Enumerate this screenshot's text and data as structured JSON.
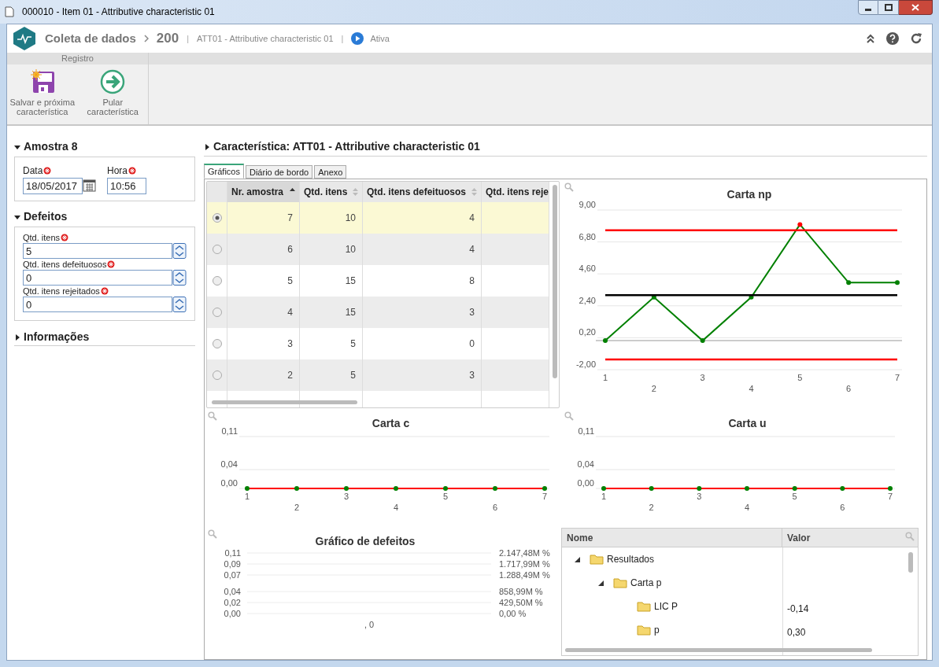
{
  "window": {
    "title": "000010 - Item 01 - Attributive characteristic 01"
  },
  "header": {
    "module": "Coleta de dados",
    "number": "200",
    "separator_1": "|",
    "characteristic": "ATT01 - Attributive characteristic 01",
    "separator_2": "|",
    "status": "Ativa"
  },
  "ribbon": {
    "group": "Registro",
    "buttons": [
      {
        "kind": "save",
        "label": "Salvar e próxima característica"
      },
      {
        "kind": "skip",
        "label": "Pular característica"
      }
    ]
  },
  "left": {
    "sample": {
      "title": "Amostra 8",
      "expanded": true,
      "date_label": "Data",
      "date": "18/05/2017",
      "time_label": "Hora",
      "time": "10:56"
    },
    "defects": {
      "title": "Defeitos",
      "expanded": true,
      "fields": [
        {
          "label": "Qtd. itens",
          "value": "5"
        },
        {
          "label": "Qtd. itens defeituosos",
          "value": "0"
        },
        {
          "label": "Qtd. itens rejeitados",
          "value": "0"
        }
      ]
    },
    "info": {
      "title": "Informações",
      "expanded": false
    }
  },
  "main": {
    "title": "Característica: ATT01 - Attributive characteristic 01",
    "tabs": [
      {
        "label": "Gráficos",
        "selected": true
      },
      {
        "label": "Diário de bordo",
        "selected": false
      },
      {
        "label": "Anexo",
        "selected": false
      }
    ],
    "table": {
      "columns": [
        "Nr. amostra",
        "Qtd. itens",
        "Qtd. itens defeituosos",
        "Qtd. itens reje"
      ],
      "rows": [
        {
          "selected": true,
          "cells": [
            "7",
            "10",
            "4",
            ""
          ]
        },
        {
          "selected": false,
          "cells": [
            "6",
            "10",
            "4",
            ""
          ]
        },
        {
          "selected": false,
          "cells": [
            "5",
            "15",
            "8",
            ""
          ]
        },
        {
          "selected": false,
          "cells": [
            "4",
            "15",
            "3",
            ""
          ]
        },
        {
          "selected": false,
          "cells": [
            "3",
            "5",
            "0",
            ""
          ]
        },
        {
          "selected": false,
          "cells": [
            "2",
            "5",
            "3",
            ""
          ]
        }
      ]
    },
    "chart_np": {
      "chart_data": {
        "type": "line",
        "title": "Carta np",
        "categories": [
          "1",
          "2",
          "3",
          "4",
          "5",
          "6",
          "7"
        ],
        "ylim": [
          -2,
          9
        ],
        "yticks": [
          {
            "value": -2,
            "label": "-2,00"
          },
          {
            "value": 0.2,
            "label": "0,20"
          },
          {
            "value": 2.4,
            "label": "2,40"
          },
          {
            "value": 4.6,
            "label": "4,60"
          },
          {
            "value": 6.8,
            "label": "6,80"
          },
          {
            "value": 9,
            "label": "9,00"
          }
        ],
        "grid": true,
        "series": [
          {
            "color": "#008000",
            "marker": true,
            "values": [
              0,
              3,
              0,
              3,
              8,
              4,
              4
            ]
          },
          {
            "color": "#ff0000",
            "values": [
              7.6,
              7.6,
              7.6,
              7.6,
              7.6,
              7.6,
              7.6
            ]
          },
          {
            "color": "#000000",
            "values": [
              3.14,
              3.14,
              3.14,
              3.14,
              3.14,
              3.14,
              3.14
            ]
          },
          {
            "color": "#ff0000",
            "values": [
              -1.3,
              -1.3,
              -1.3,
              -1.3,
              -1.3,
              -1.3,
              -1.3
            ]
          }
        ]
      }
    },
    "chart_c": {
      "chart_data": {
        "type": "line",
        "title": "Carta c",
        "categories": [
          "1",
          "2",
          "3",
          "4",
          "5",
          "6",
          "7"
        ],
        "ylim": [
          0,
          0.11
        ],
        "yticks": [
          {
            "value": 0,
            "label": "0,00"
          },
          {
            "value": 0.04,
            "label": "0,04"
          },
          {
            "value": 0.11,
            "label": "0,11"
          }
        ],
        "grid": true,
        "series": [
          {
            "color": "#ff0000",
            "marker": true,
            "values": [
              0,
              0,
              0,
              0,
              0,
              0,
              0
            ]
          }
        ]
      }
    },
    "chart_u": {
      "chart_data": {
        "type": "line",
        "title": "Carta u",
        "categories": [
          "1",
          "2",
          "3",
          "4",
          "5",
          "6",
          "7"
        ],
        "ylim": [
          0,
          0.11
        ],
        "yticks": [
          {
            "value": 0,
            "label": "0,00"
          },
          {
            "value": 0.04,
            "label": "0,04"
          },
          {
            "value": 0.11,
            "label": "0,11"
          }
        ],
        "grid": true,
        "series": [
          {
            "color": "#ff0000",
            "marker": true,
            "values": [
              0,
              0,
              0,
              0,
              0,
              0,
              0
            ]
          }
        ]
      }
    },
    "chart_defects": {
      "chart_data": {
        "type": "bar",
        "grid": true,
        "title": "Gráfico de defeitos",
        "categories": [
          ", 0"
        ],
        "values": [
          0
        ],
        "ylim": [
          0,
          0.11
        ],
        "yticks": [
          {
            "value": 0,
            "label": "0,00"
          },
          {
            "value": 0.02,
            "label": "0,02"
          },
          {
            "value": 0.04,
            "label": "0,04"
          },
          {
            "value": 0.07,
            "label": "0,07"
          },
          {
            "value": 0.09,
            "label": "0,09"
          },
          {
            "value": 0.11,
            "label": "0,11"
          }
        ]
      },
      "right_axis_labels": [
        "2.147,48M %",
        "1.717,99M %",
        "1.288,49M %",
        "858,99M %",
        "429,50M %",
        "0,00 %"
      ]
    },
    "results": {
      "columns": [
        "Nome",
        "Valor"
      ],
      "rows": [
        {
          "name": "Resultados",
          "expanded": true,
          "children": [
            {
              "name": "Carta p",
              "expanded": true,
              "children": [
                {
                  "name": "LIC P",
                  "value": "-0,14"
                },
                {
                  "name": "p",
                  "value": "0,30"
                }
              ]
            }
          ]
        }
      ]
    }
  }
}
